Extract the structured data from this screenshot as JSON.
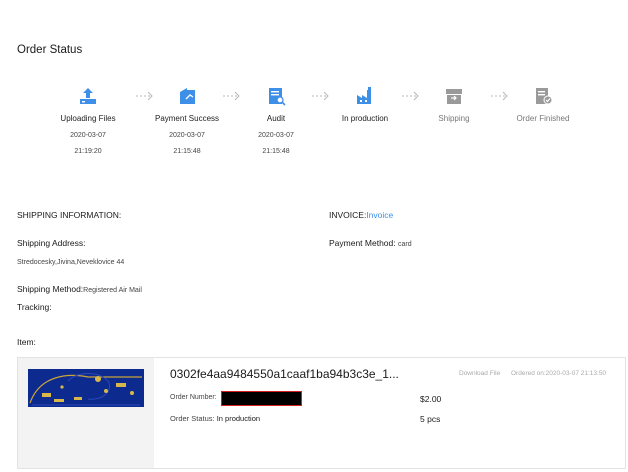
{
  "page": {
    "title": "Order Status"
  },
  "steps": [
    {
      "label": "Uploading Files",
      "date": "2020-03-07",
      "time": "21:19:20",
      "icon": "upload-icon",
      "state": "done"
    },
    {
      "label": "Payment Success",
      "date": "2020-03-07",
      "time": "21:15:48",
      "icon": "payment-icon",
      "state": "done"
    },
    {
      "label": "Audit",
      "date": "2020-03-07",
      "time": "21:15:48",
      "icon": "audit-icon",
      "state": "done"
    },
    {
      "label": "In production",
      "date": "",
      "time": "",
      "icon": "factory-icon",
      "state": "current"
    },
    {
      "label": "Shipping",
      "date": "",
      "time": "",
      "icon": "box-icon",
      "state": "pending"
    },
    {
      "label": "Order Finished",
      "date": "",
      "time": "",
      "icon": "finished-icon",
      "state": "pending"
    }
  ],
  "shipping": {
    "heading": "SHIPPING INFORMATION:",
    "address_label": "Shipping Address:",
    "address_value": "Stredocesky,Jivina,Neveklovice 44",
    "method_label": "Shipping Method:",
    "method_value": "Registered Air Mail",
    "tracking_label": "Tracking:"
  },
  "invoice": {
    "label": "INVOICE:",
    "link": "Invoice",
    "payment_label": "Payment Method:",
    "payment_value": "card"
  },
  "item": {
    "heading": "Item:",
    "name": "0302fe4aa9484550a1caaf1ba94b3c3e_1...",
    "download": "Download File",
    "ordered_on": "Ordered on:2020-03-07 21:13:50",
    "order_number_label": "Order Number:",
    "price": "$2.00",
    "status_label": "Order Status:",
    "status_value": "In production",
    "qty": "5 pcs"
  },
  "colors": {
    "accent": "#3d8fe8",
    "pending": "#9a9a9a",
    "redact_border": "#d62020"
  }
}
